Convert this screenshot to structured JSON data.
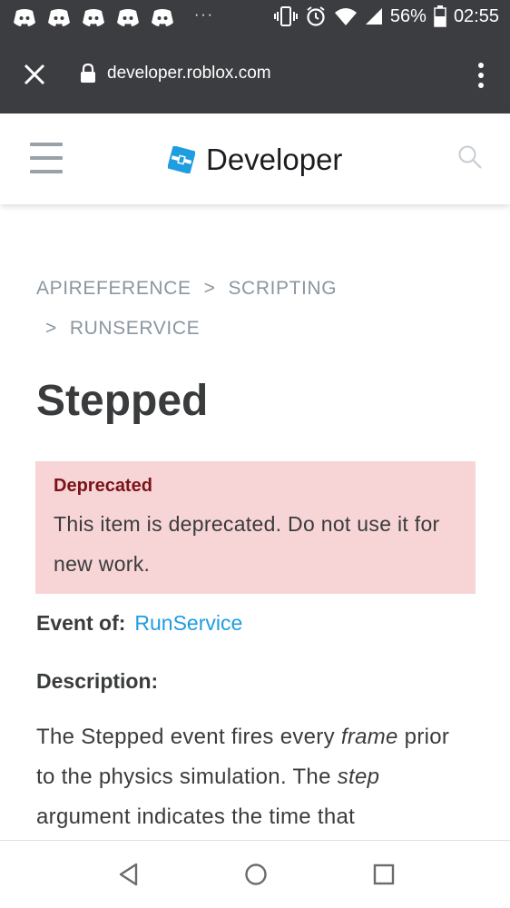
{
  "status_bar": {
    "battery": "56%",
    "time": "02:55",
    "overflow": "···"
  },
  "browser": {
    "url": "developer.roblox.com"
  },
  "header": {
    "logo_text": "Developer"
  },
  "breadcrumb": {
    "items": [
      "APIREFERENCE",
      "SCRIPTING",
      "RUNSERVICE"
    ],
    "separator": ">"
  },
  "page": {
    "title": "Stepped",
    "deprecated": {
      "title": "Deprecated",
      "text": "This item is deprecated. Do not use it for new work."
    },
    "event_of_label": "Event of:",
    "event_of_link": "RunService",
    "description_label": "Description:",
    "description": {
      "part1": "The Stepped event fires every ",
      "em1": "frame",
      "part2": " prior to the physics simulation. The ",
      "em2": "step",
      "part3": " argument indicates the time that"
    }
  },
  "colors": {
    "chrome": "#3c3d41",
    "link": "#1e9de0",
    "deprecated_bg": "#f7d4d5",
    "deprecated_title": "#7a1318",
    "text": "#393b3d",
    "muted": "#8b96a0"
  }
}
